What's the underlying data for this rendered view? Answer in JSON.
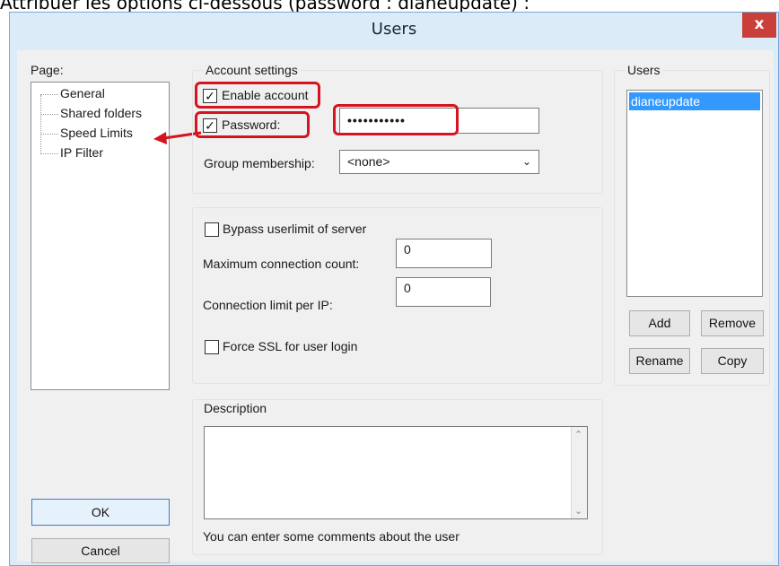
{
  "caption": "Attribuer les options ci-dessous (password : dianeupdate) :",
  "window": {
    "title": "Users",
    "close": "x"
  },
  "page": {
    "label": "Page:",
    "items": [
      "General",
      "Shared folders",
      "Speed Limits",
      "IP Filter"
    ]
  },
  "account": {
    "group_label": "Account settings",
    "enable_account": "Enable account",
    "enable_checked": true,
    "password_label": "Password:",
    "password_checked": true,
    "password_value": "•••••••••••",
    "group_membership_label": "Group membership:",
    "group_membership_value": "<none>"
  },
  "limits": {
    "bypass_label": "Bypass userlimit of server",
    "max_conn_label": "Maximum connection count:",
    "max_conn_value": "0",
    "per_ip_label": "Connection limit per IP:",
    "per_ip_value": "0",
    "force_ssl_label": "Force SSL for user login"
  },
  "description": {
    "label": "Description",
    "hint": "You can enter some comments about the user"
  },
  "users": {
    "label": "Users",
    "list": [
      "dianeupdate"
    ],
    "add": "Add",
    "remove": "Remove",
    "rename": "Rename",
    "copy": "Copy"
  },
  "buttons": {
    "ok": "OK",
    "cancel": "Cancel"
  },
  "colors": {
    "highlight": "#d6141f",
    "selection": "#3399ff",
    "close": "#c9403b"
  }
}
